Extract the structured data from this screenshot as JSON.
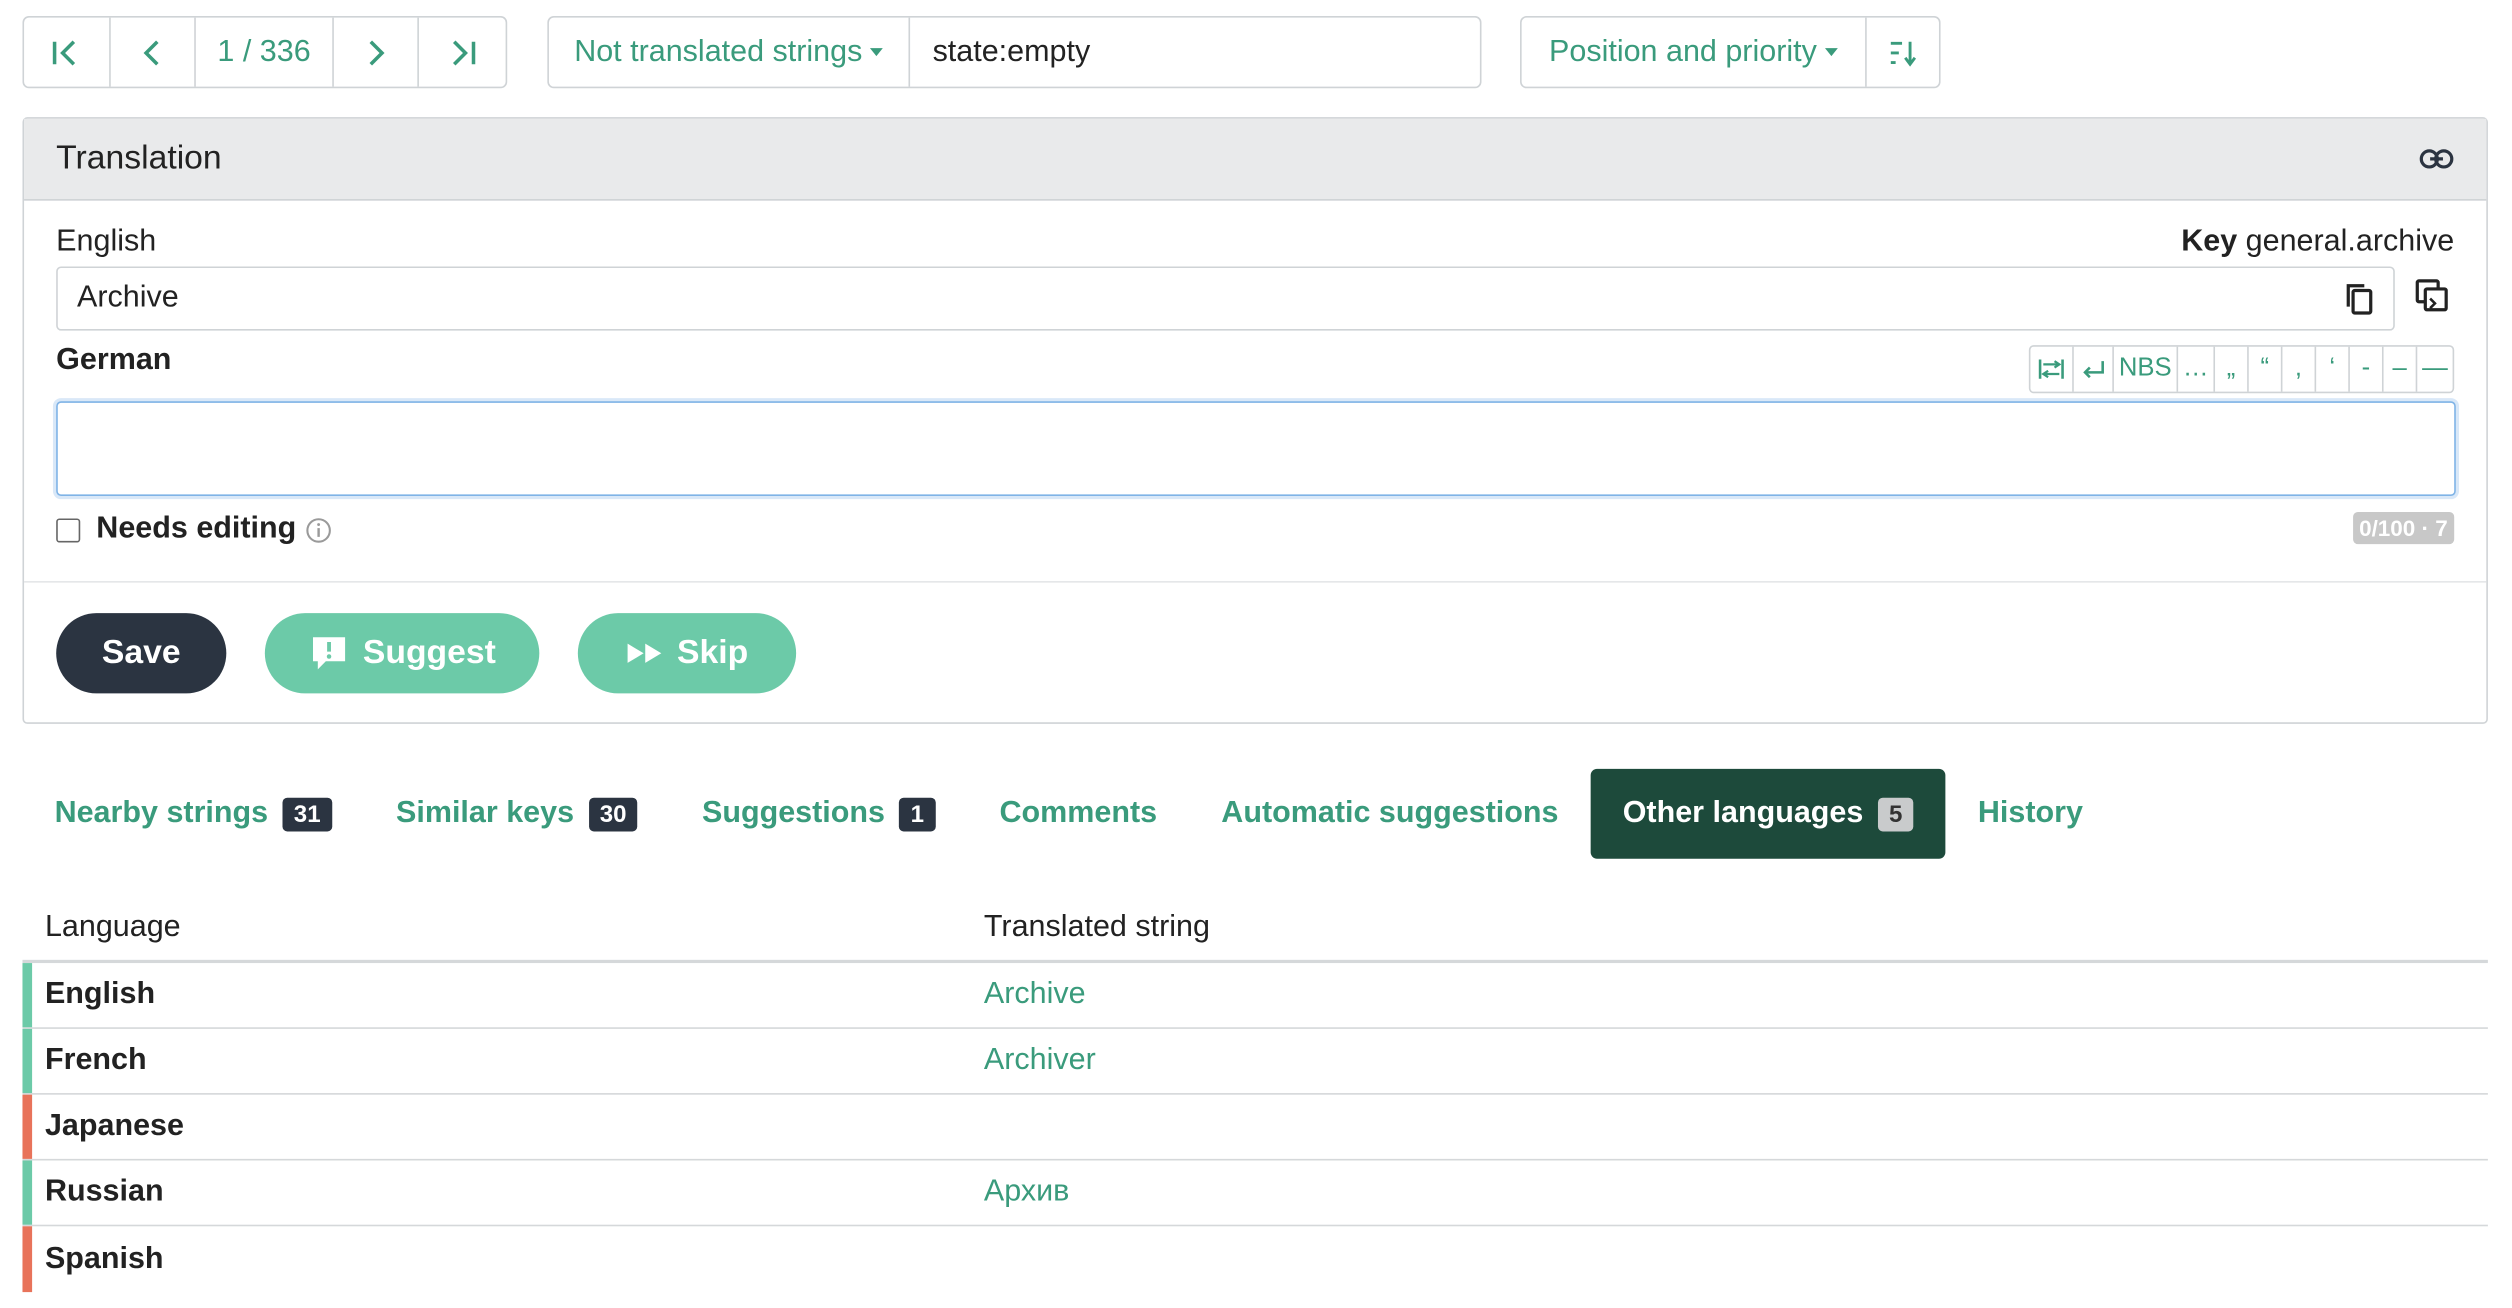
{
  "toolbar": {
    "pager": {
      "position": "1 / 336"
    },
    "filter": {
      "label": "Not translated strings",
      "query": "state:empty"
    },
    "sort": {
      "label": "Position and priority"
    }
  },
  "panel": {
    "title": "Translation",
    "source_language": "English",
    "key_label": "Key",
    "key_value": "general.archive",
    "source_text": "Archive",
    "target_language": "German",
    "target_text": "",
    "special_chars": [
      "NBS",
      "…",
      "„",
      "“",
      ",",
      "‘",
      "-",
      "–",
      "—"
    ],
    "needs_editing_label": "Needs editing",
    "counter": "0/100 · 7",
    "buttons": {
      "save": "Save",
      "suggest": "Suggest",
      "skip": "Skip"
    }
  },
  "tabs": [
    {
      "label": "Nearby strings",
      "badge": "31"
    },
    {
      "label": "Similar keys",
      "badge": "30"
    },
    {
      "label": "Suggestions",
      "badge": "1"
    },
    {
      "label": "Comments",
      "badge": ""
    },
    {
      "label": "Automatic suggestions",
      "badge": ""
    },
    {
      "label": "Other languages",
      "badge": "5"
    },
    {
      "label": "History",
      "badge": ""
    }
  ],
  "table": {
    "headers": {
      "language": "Language",
      "translated": "Translated string"
    },
    "rows": [
      {
        "language": "English",
        "string": "Archive",
        "status_color": "#6ccaa8"
      },
      {
        "language": "French",
        "string": "Archiver",
        "status_color": "#6ccaa8"
      },
      {
        "language": "Japanese",
        "string": "",
        "status_color": "#e8735a"
      },
      {
        "language": "Russian",
        "string": "Архив",
        "status_color": "#6ccaa8"
      },
      {
        "language": "Spanish",
        "string": "",
        "status_color": "#e8735a"
      }
    ]
  },
  "colors": {
    "accent": "#3a9b7c",
    "dark": "#2b3441",
    "active_tab": "#1d4a3b",
    "button_green": "#6ccaa8"
  }
}
